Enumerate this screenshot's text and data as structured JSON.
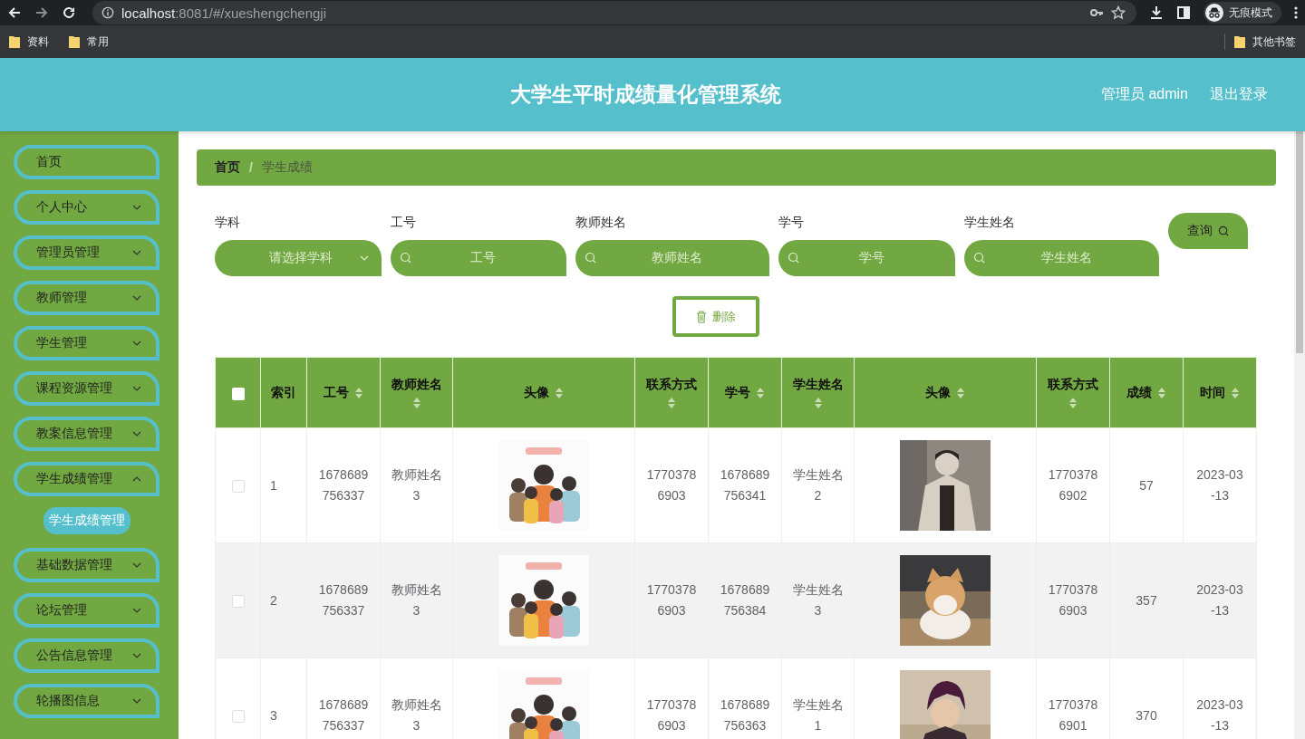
{
  "browser": {
    "url_host": "localhost",
    "url_rest": ":8081/#/xueshengchengji",
    "incognito_label": "无痕模式",
    "bookmarks": [
      "资料",
      "常用"
    ],
    "other_bookmarks": "其他书签"
  },
  "header": {
    "title": "大学生平时成绩量化管理系统",
    "user": "管理员 admin",
    "logout": "退出登录"
  },
  "sidebar": {
    "items": [
      {
        "label": "首页",
        "kind": "link"
      },
      {
        "label": "个人中心",
        "kind": "menu",
        "expanded": false
      },
      {
        "label": "管理员管理",
        "kind": "menu",
        "expanded": false
      },
      {
        "label": "教师管理",
        "kind": "menu",
        "expanded": false
      },
      {
        "label": "学生管理",
        "kind": "menu",
        "expanded": false
      },
      {
        "label": "课程资源管理",
        "kind": "menu",
        "expanded": false
      },
      {
        "label": "教案信息管理",
        "kind": "menu",
        "expanded": false
      },
      {
        "label": "学生成绩管理",
        "kind": "menu",
        "expanded": true,
        "children": [
          {
            "label": "学生成绩管理",
            "selected": true
          }
        ]
      },
      {
        "label": "基础数据管理",
        "kind": "menu",
        "expanded": false
      },
      {
        "label": "论坛管理",
        "kind": "menu",
        "expanded": false
      },
      {
        "label": "公告信息管理",
        "kind": "menu",
        "expanded": false
      },
      {
        "label": "轮播图信息",
        "kind": "menu",
        "expanded": false
      }
    ]
  },
  "breadcrumb": [
    "首页",
    "学生成绩"
  ],
  "breadcrumb_separator": "/",
  "filters": [
    {
      "label": "学科",
      "kind": "select",
      "placeholder": "请选择学科"
    },
    {
      "label": "工号",
      "kind": "search",
      "placeholder": "工号"
    },
    {
      "label": "教师姓名",
      "kind": "search",
      "placeholder": "教师姓名"
    },
    {
      "label": "学号",
      "kind": "search",
      "placeholder": "学号"
    },
    {
      "label": "学生姓名",
      "kind": "search",
      "placeholder": "学生姓名"
    }
  ],
  "search_button": "查询",
  "delete_button": "删除",
  "table": {
    "select_all": {
      "checked": false
    },
    "columns": [
      {
        "label": "索引",
        "sortable": false
      },
      {
        "label": "工号",
        "sortable": true
      },
      {
        "label": "教师姓名",
        "sortable": true
      },
      {
        "label": "头像",
        "sortable": true
      },
      {
        "label": "联系方式",
        "sortable": true
      },
      {
        "label": "学号",
        "sortable": true
      },
      {
        "label": "学生姓名",
        "sortable": true
      },
      {
        "label": "头像",
        "sortable": true
      },
      {
        "label": "联系方式",
        "sortable": true
      },
      {
        "label": "成绩",
        "sortable": true
      },
      {
        "label": "时间",
        "sortable": true
      }
    ],
    "rows": [
      {
        "checked": false,
        "highlighted": false,
        "index": "1",
        "teacher_id": "1678689756337",
        "teacher_name": "教师姓名3",
        "teacher_phone": "17703786903",
        "student_id": "1678689756341",
        "student_name": "学生姓名2",
        "student_phone": "17703786902",
        "score": "57",
        "time": "2023-03-13"
      },
      {
        "checked": false,
        "highlighted": true,
        "index": "2",
        "teacher_id": "1678689756337",
        "teacher_name": "教师姓名3",
        "teacher_phone": "17703786903",
        "student_id": "1678689756384",
        "student_name": "学生姓名3",
        "student_phone": "17703786903",
        "score": "357",
        "time": "2023-03-13"
      },
      {
        "checked": false,
        "highlighted": false,
        "index": "3",
        "teacher_id": "1678689756337",
        "teacher_name": "教师姓名3",
        "teacher_phone": "17703786903",
        "student_id": "1678689756363",
        "student_name": "学生姓名1",
        "student_phone": "17703786901",
        "score": "370",
        "time": "2023-03-13"
      }
    ]
  }
}
